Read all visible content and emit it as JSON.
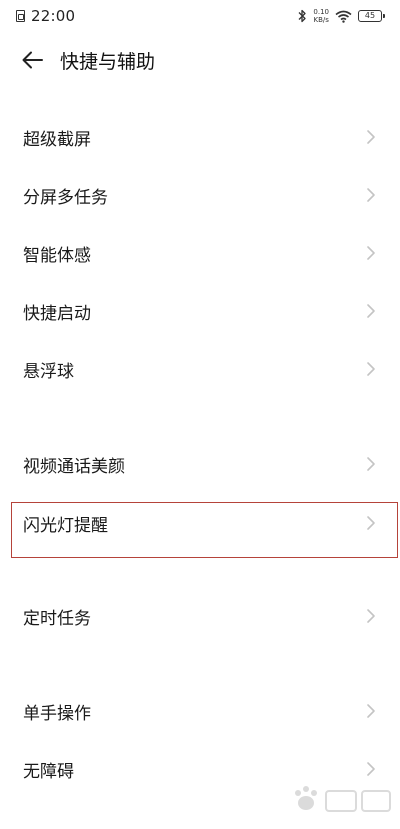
{
  "status_bar": {
    "time": "22:00",
    "net_speed_value": "0.10",
    "net_speed_unit": "KB/s",
    "battery": "45"
  },
  "header": {
    "title": "快捷与辅助"
  },
  "settings": {
    "items": [
      {
        "label": "超级截屏"
      },
      {
        "label": "分屏多任务"
      },
      {
        "label": "智能体感"
      },
      {
        "label": "快捷启动"
      },
      {
        "label": "悬浮球"
      },
      {
        "label": "视频通话美颜"
      },
      {
        "label": "闪光灯提醒"
      },
      {
        "label": "定时任务"
      },
      {
        "label": "单手操作"
      },
      {
        "label": "无障碍"
      }
    ]
  },
  "colors": {
    "highlight_border": "#b5433a",
    "chevron": "#c4c4c4",
    "text": "#1a1a1a"
  },
  "icons": {
    "back": "arrow-left-icon",
    "chevron": "chevron-right-icon",
    "bluetooth": "bluetooth-icon",
    "wifi": "wifi-icon",
    "battery": "battery-icon",
    "sim": "sim-card-icon"
  }
}
